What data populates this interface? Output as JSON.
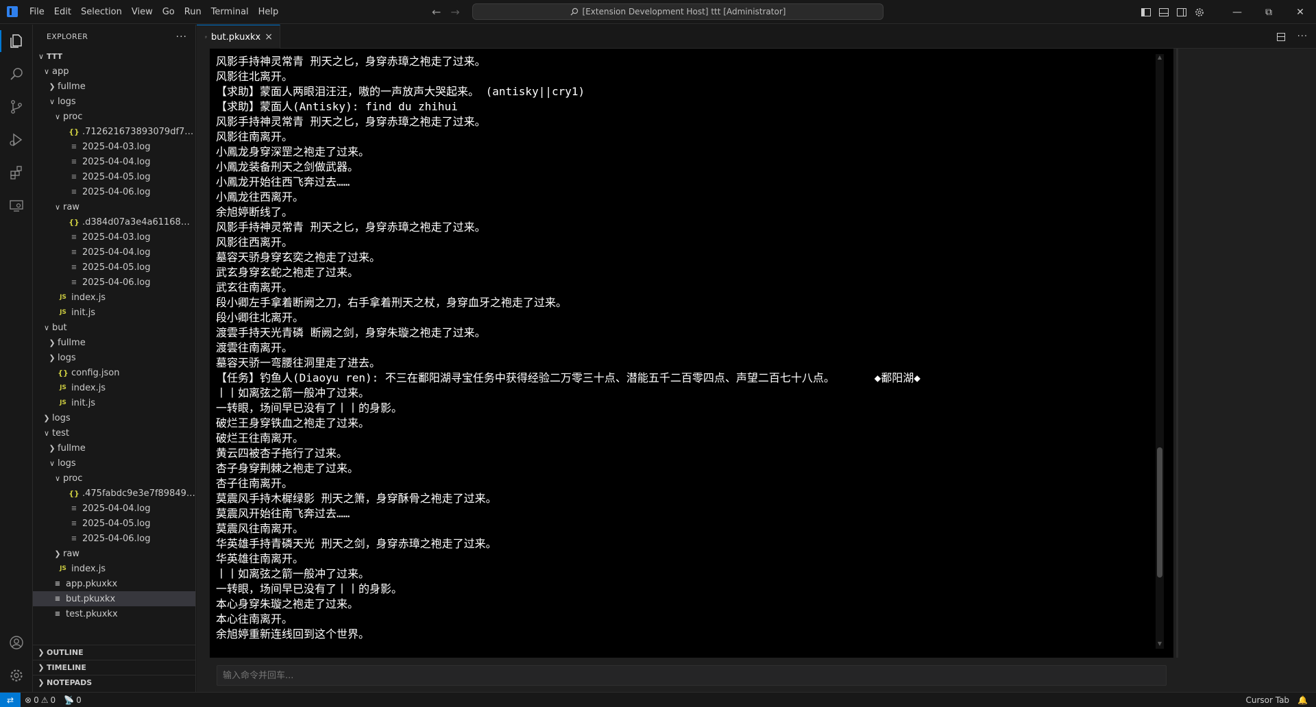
{
  "menu": [
    "File",
    "Edit",
    "Selection",
    "View",
    "Go",
    "Run",
    "Terminal",
    "Help"
  ],
  "command_center": {
    "text": "[Extension Development Host] ttt [Administrator]"
  },
  "explorer": {
    "title": "EXPLORER",
    "more": "···"
  },
  "tree": [
    {
      "label": "TTT",
      "depth": 0,
      "type": "root",
      "expanded": true
    },
    {
      "label": "app",
      "depth": 1,
      "type": "folder",
      "expanded": true
    },
    {
      "label": "fullme",
      "depth": 2,
      "type": "folder",
      "expanded": false
    },
    {
      "label": "logs",
      "depth": 2,
      "type": "folder",
      "expanded": true
    },
    {
      "label": "proc",
      "depth": 3,
      "type": "folder",
      "expanded": true
    },
    {
      "label": ".712621673893079df70de2fb...",
      "depth": 4,
      "type": "json"
    },
    {
      "label": "2025-04-03.log",
      "depth": 4,
      "type": "log"
    },
    {
      "label": "2025-04-04.log",
      "depth": 4,
      "type": "log"
    },
    {
      "label": "2025-04-05.log",
      "depth": 4,
      "type": "log"
    },
    {
      "label": "2025-04-06.log",
      "depth": 4,
      "type": "log"
    },
    {
      "label": "raw",
      "depth": 3,
      "type": "folder",
      "expanded": true
    },
    {
      "label": ".d384d07a3e4a6116851e247...",
      "depth": 4,
      "type": "json"
    },
    {
      "label": "2025-04-03.log",
      "depth": 4,
      "type": "log"
    },
    {
      "label": "2025-04-04.log",
      "depth": 4,
      "type": "log"
    },
    {
      "label": "2025-04-05.log",
      "depth": 4,
      "type": "log"
    },
    {
      "label": "2025-04-06.log",
      "depth": 4,
      "type": "log"
    },
    {
      "label": "index.js",
      "depth": 2,
      "type": "js"
    },
    {
      "label": "init.js",
      "depth": 2,
      "type": "js"
    },
    {
      "label": "but",
      "depth": 1,
      "type": "folder",
      "expanded": true
    },
    {
      "label": "fullme",
      "depth": 2,
      "type": "folder",
      "expanded": false
    },
    {
      "label": "logs",
      "depth": 2,
      "type": "folder",
      "expanded": false
    },
    {
      "label": "config.json",
      "depth": 2,
      "type": "json"
    },
    {
      "label": "index.js",
      "depth": 2,
      "type": "js"
    },
    {
      "label": "init.js",
      "depth": 2,
      "type": "js"
    },
    {
      "label": "logs",
      "depth": 1,
      "type": "folder",
      "expanded": false
    },
    {
      "label": "test",
      "depth": 1,
      "type": "folder",
      "expanded": true
    },
    {
      "label": "fullme",
      "depth": 2,
      "type": "folder",
      "expanded": false
    },
    {
      "label": "logs",
      "depth": 2,
      "type": "folder",
      "expanded": true
    },
    {
      "label": "proc",
      "depth": 3,
      "type": "folder",
      "expanded": true
    },
    {
      "label": ".475fabdc9e3e7f89849c6a9a...",
      "depth": 4,
      "type": "json"
    },
    {
      "label": "2025-04-04.log",
      "depth": 4,
      "type": "log"
    },
    {
      "label": "2025-04-05.log",
      "depth": 4,
      "type": "log"
    },
    {
      "label": "2025-04-06.log",
      "depth": 4,
      "type": "log"
    },
    {
      "label": "raw",
      "depth": 3,
      "type": "folder",
      "expanded": false
    },
    {
      "label": "index.js",
      "depth": 2,
      "type": "js"
    },
    {
      "label": "app.pkuxkx",
      "depth": 1,
      "type": "file"
    },
    {
      "label": "but.pkuxkx",
      "depth": 1,
      "type": "file",
      "selected": true
    },
    {
      "label": "test.pkuxkx",
      "depth": 1,
      "type": "file"
    }
  ],
  "sections": [
    "OUTLINE",
    "TIMELINE",
    "NOTEPADS"
  ],
  "tab": {
    "label": "but.pkuxkx",
    "close": "×"
  },
  "terminal_lines": [
    "风影手持神灵常青 刑天之匕，身穿赤璋之袍走了过来。",
    "风影往北离开。",
    "【求助】蒙面人两眼泪汪汪，嗷的一声放声大哭起来。 (antisky||cry1)",
    "【求助】蒙面人(Antisky): find du zhihui",
    "风影手持神灵常青 刑天之匕，身穿赤璋之袍走了过来。",
    "风影往南离开。",
    "小鳳龙身穿深罡之袍走了过来。",
    "小鳳龙装备刑天之剑做武器。",
    "小鳳龙开始往西飞奔过去……",
    "小鳳龙往西离开。",
    "余旭婷断线了。",
    "风影手持神灵常青 刑天之匕，身穿赤璋之袍走了过来。",
    "风影往西离开。",
    "墓容天骄身穿玄奕之袍走了过来。",
    "武玄身穿玄蛇之袍走了过来。",
    "武玄往南离开。",
    "段小卿左手拿着断阙之刀，右手拿着刑天之杖，身穿血牙之袍走了过来。",
    "段小卿往北离开。",
    "渡雲手持天光青磷 断阙之剑，身穿朱璇之袍走了过来。",
    "渡雲往南离开。",
    "墓容天骄一弯腰往洞里走了进去。",
    "【任务】钓鱼人(Diaoyu ren): 不三在鄱阳湖寻宝任务中获得经验二万零三十点、潜能五千二百零四点、声望二百七十八点。      ◆鄱阳湖◆",
    "丨丨如离弦之箭一般冲了过来。",
    "一转眼，场间早已没有了丨丨的身影。",
    "破烂王身穿铁血之袍走了过来。",
    "破烂王往南离开。",
    "黄云四被杏子拖行了过来。",
    "杏子身穿荆棘之袍走了过来。",
    "杏子往南离开。",
    "莫震风手持木樨绿影 刑天之箫，身穿酥骨之袍走了过来。",
    "莫震风开始往南飞奔过去……",
    "莫震风往南离开。",
    "华英雄手持青磷天光 刑天之剑，身穿赤璋之袍走了过来。",
    "华英雄往南离开。",
    "丨丨如离弦之箭一般冲了过来。",
    "一转眼，场间早已没有了丨丨的身影。",
    "本心身穿朱璇之袍走了过来。",
    "本心往南离开。",
    "余旭婷重新连线回到这个世界。"
  ],
  "input": {
    "placeholder": "输入命令并回车..."
  },
  "status": {
    "errors": "0",
    "warnings": "0",
    "ports": "0",
    "cursor_tab": "Cursor Tab"
  }
}
